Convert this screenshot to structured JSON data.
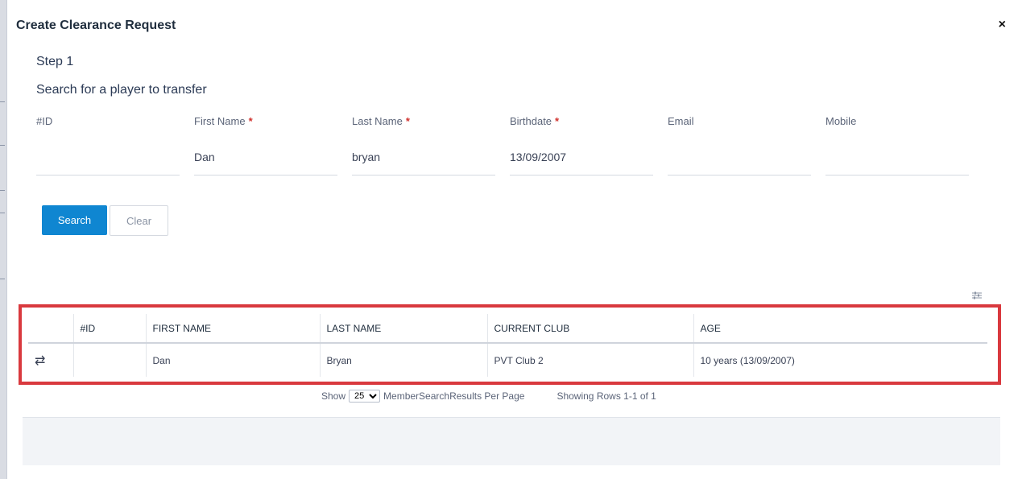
{
  "modal": {
    "title": "Create Clearance Request",
    "close_glyph": "×"
  },
  "step": {
    "label": "Step 1",
    "subtitle": "Search for a player to transfer"
  },
  "search_form": {
    "fields": [
      {
        "label": "#ID",
        "required": false,
        "value": ""
      },
      {
        "label": "First Name",
        "required": true,
        "value": "Dan"
      },
      {
        "label": "Last Name",
        "required": true,
        "value": "bryan"
      },
      {
        "label": "Birthdate",
        "required": true,
        "value": "13/09/2007"
      },
      {
        "label": "Email",
        "required": false,
        "value": ""
      },
      {
        "label": "Mobile",
        "required": false,
        "value": ""
      }
    ],
    "required_marker": "*",
    "search_label": "Search",
    "clear_label": "Clear"
  },
  "results": {
    "columns": [
      "#ID",
      "FIRST NAME",
      "LAST NAME",
      "CURRENT CLUB",
      "AGE"
    ],
    "rows": [
      {
        "action_icon": "⇄",
        "id": "",
        "first_name": "Dan",
        "last_name": "Bryan",
        "current_club": "PVT Club 2",
        "age": "10 years (13/09/2007)"
      }
    ],
    "highlight_color": "#d9393e"
  },
  "pager": {
    "show_label": "Show",
    "page_size": "25",
    "per_page_label": "MemberSearchResults Per Page",
    "rows_info": "Showing Rows 1-1 of 1"
  },
  "colors": {
    "primary": "#0f86d1",
    "required": "#d0312d"
  },
  "icons": {
    "close": "close-icon",
    "transfer": "transfer-icon",
    "column_settings": "sliders-icon"
  }
}
